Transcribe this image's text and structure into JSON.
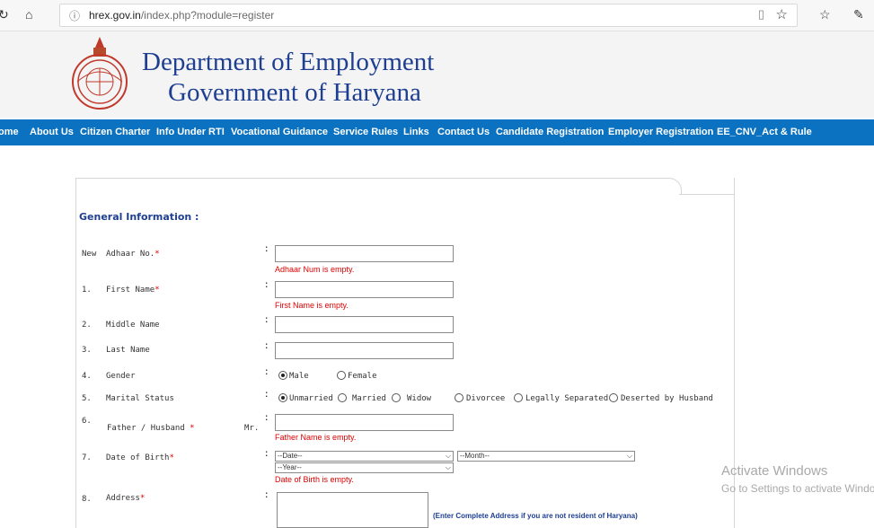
{
  "browser": {
    "url_domain": "hrex.gov.in",
    "url_path": "/index.php?module=register"
  },
  "header": {
    "line1": "Department of Employment",
    "line2": "Government of Haryana"
  },
  "nav": [
    "ome",
    "About Us",
    "Citizen Charter",
    "Info Under RTI",
    "Vocational Guidance",
    "Service Rules",
    "Links",
    "Contact Us",
    "Candidate Registration",
    "Employer Registration",
    "EE_CNV_Act & Rule"
  ],
  "form": {
    "section_title": "General Information :",
    "adhaar": {
      "prefix": "New",
      "label": "Adhaar No.",
      "error": "Adhaar Num is empty."
    },
    "first_name": {
      "num": "1.",
      "label": "First Name",
      "error": "First Name is empty."
    },
    "middle_name": {
      "num": "2.",
      "label": "Middle Name"
    },
    "last_name": {
      "num": "3.",
      "label": "Last Name"
    },
    "gender": {
      "num": "4.",
      "label": "Gender",
      "options": [
        "Male",
        "Female"
      ],
      "selected": "Male"
    },
    "marital": {
      "num": "5.",
      "label": "Marital Status",
      "options": [
        "Unmarried",
        "Married",
        "Widow",
        "Divorcee",
        "Legally Separated",
        "Deserted by Husband"
      ],
      "selected": "Unmarried"
    },
    "father": {
      "num": "6.",
      "label": "Father / Husband",
      "mr": "Mr.",
      "error": "Father Name is empty."
    },
    "dob": {
      "num": "7.",
      "label": "Date of Birth",
      "date": "--Date--",
      "month": "--Month--",
      "year": "--Year--",
      "error": "Date of Birth is empty."
    },
    "address": {
      "num": "8.",
      "label": "Address",
      "note": "(Enter Complete Address if you are not resident of Haryana)"
    },
    "required_mark": "*"
  },
  "watermark": {
    "line1": "Activate Windows",
    "line2": "Go to Settings to activate Windo"
  }
}
